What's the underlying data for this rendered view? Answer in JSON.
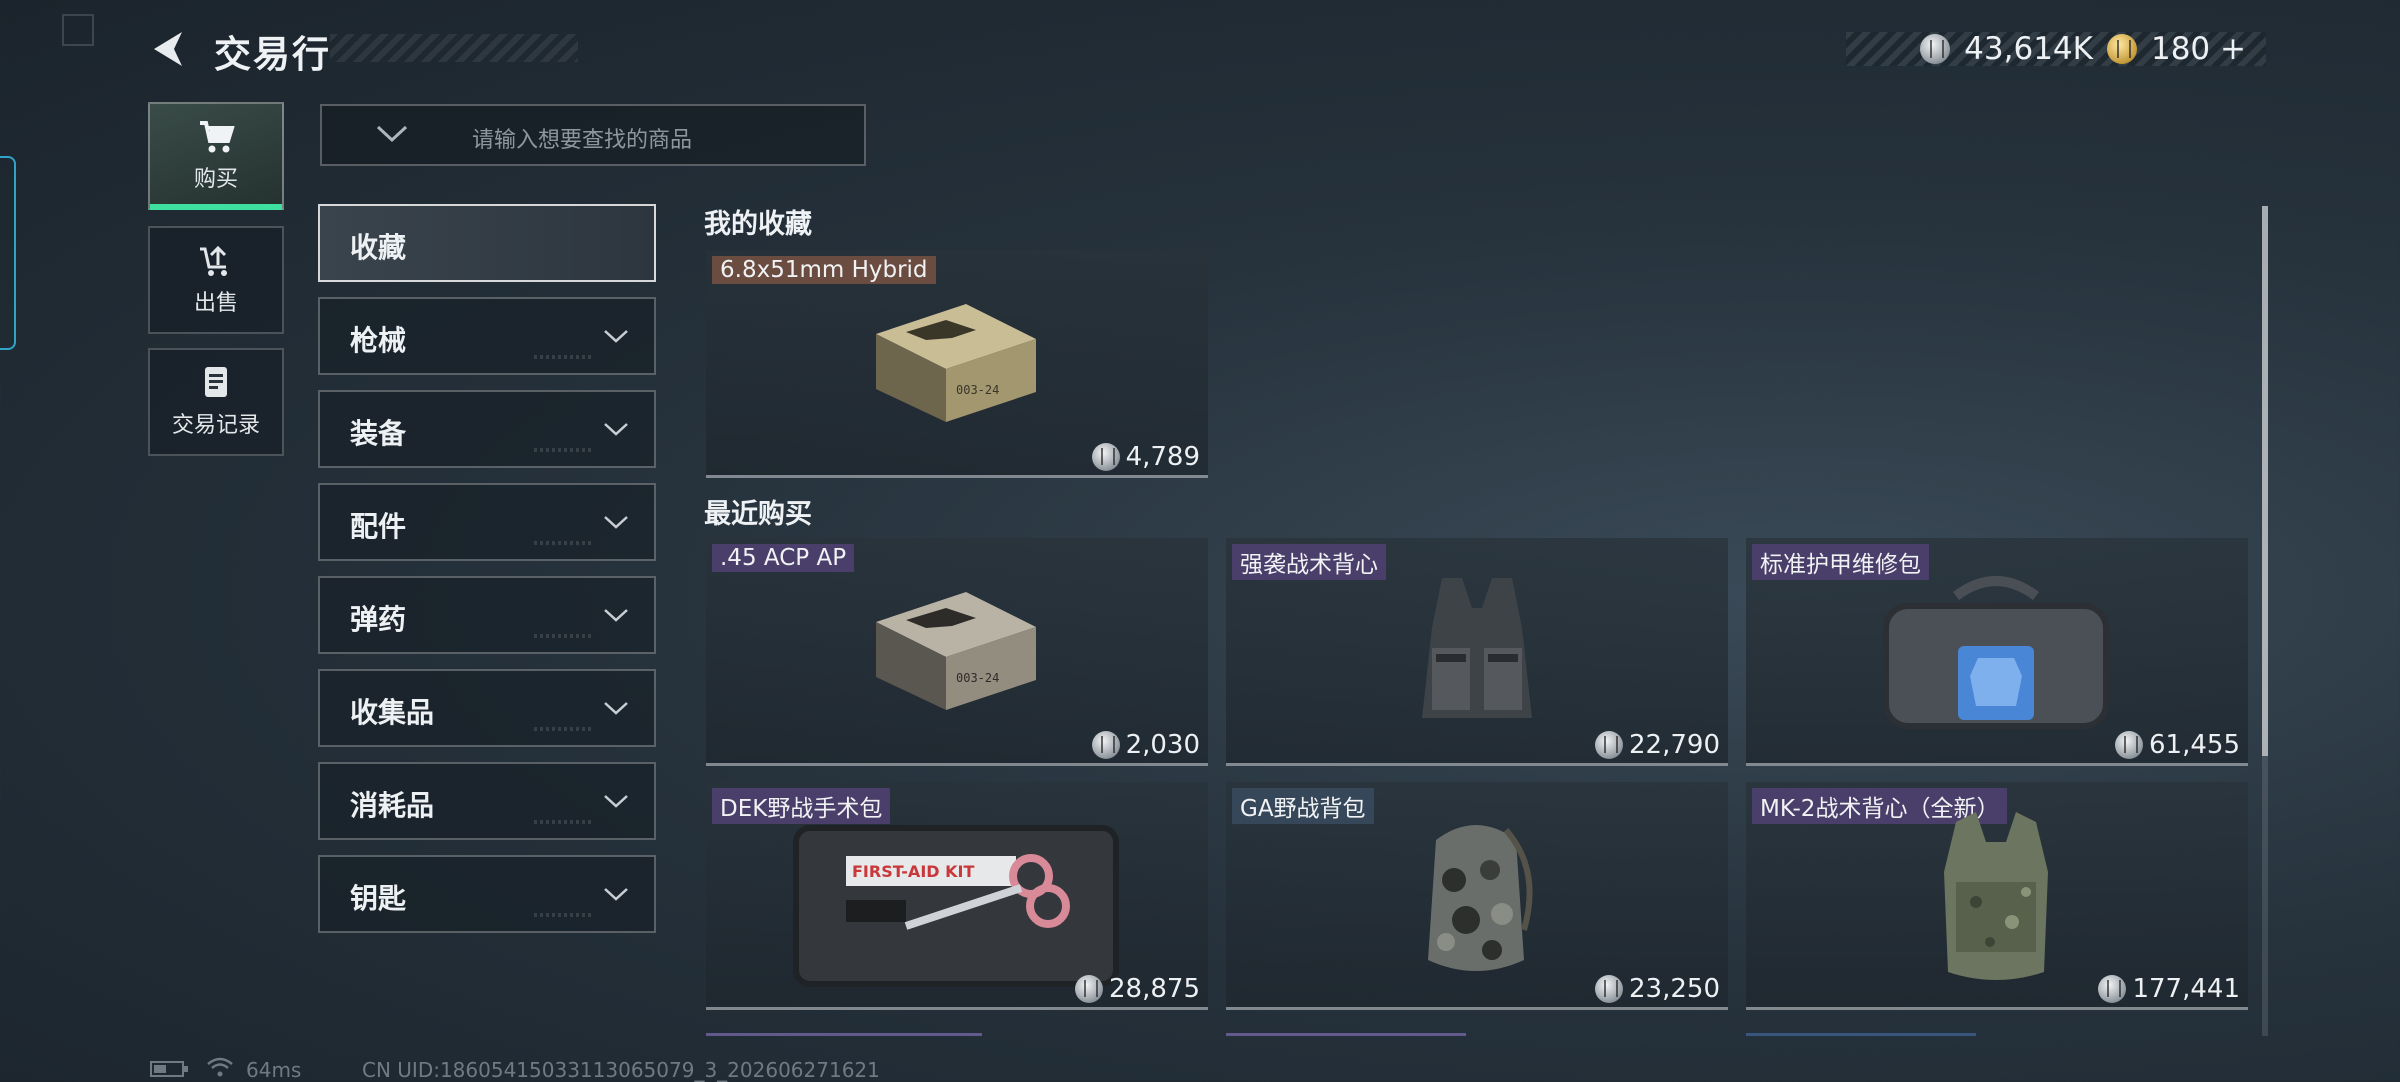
{
  "header": {
    "title": "交易行"
  },
  "currency": {
    "silver": "43,614K",
    "gold": "180",
    "gold_add": "+"
  },
  "nav": [
    {
      "label": "购买",
      "icon": "cart-icon"
    },
    {
      "label": "出售",
      "icon": "sell-upload-icon"
    },
    {
      "label": "交易记录",
      "icon": "record-list-icon"
    }
  ],
  "search": {
    "placeholder": "请输入想要查找的商品"
  },
  "categories": [
    "收藏",
    "枪械",
    "装备",
    "配件",
    "弹药",
    "收集品",
    "消耗品",
    "钥匙"
  ],
  "sections": {
    "favorites_title": "我的收藏",
    "recent_title": "最近购买"
  },
  "favorites": [
    {
      "name": "6.8x51mm Hybrid",
      "price": "4,789"
    }
  ],
  "recent": [
    {
      "name": ".45 ACP AP",
      "price": "2,030"
    },
    {
      "name": "强袭战术背心",
      "price": "22,790"
    },
    {
      "name": "标准护甲维修包",
      "price": "61,455"
    },
    {
      "name": "DEK野战手术包",
      "price": "28,875"
    },
    {
      "name": "GA野战背包",
      "price": "23,250"
    },
    {
      "name": "MK-2战术背心（全新）",
      "price": "177,441"
    }
  ],
  "kit_text": "FIRST-AID KIT",
  "ammo_box_text": "003-24",
  "footer": {
    "ping": "64ms",
    "uid": "CN UID:18605415033113065079_3_202606271621"
  },
  "colors": {
    "accent": "#3ee0a0",
    "name_purple": "#4a3f6a",
    "name_brown": "#6a4c40",
    "name_slate": "#36475a"
  }
}
